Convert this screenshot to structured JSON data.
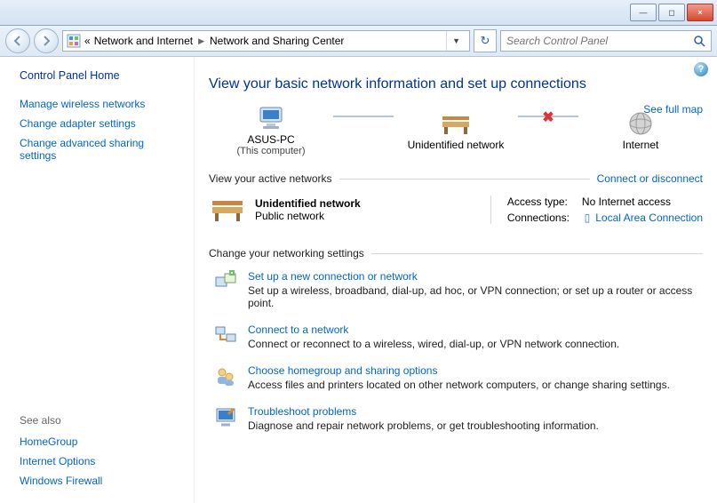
{
  "titlebar": {
    "minimize": "—",
    "maximize": "◻",
    "close": "×"
  },
  "breadcrumb": {
    "prefix": "«",
    "part1": "Network and Internet",
    "part2": "Network and Sharing Center"
  },
  "search": {
    "placeholder": "Search Control Panel"
  },
  "sidebar": {
    "home": "Control Panel Home",
    "links": [
      "Manage wireless networks",
      "Change adapter settings",
      "Change advanced sharing settings"
    ],
    "seealso_header": "See also",
    "seealso": [
      "HomeGroup",
      "Internet Options",
      "Windows Firewall"
    ]
  },
  "main": {
    "title": "View your basic network information and set up connections",
    "fullmap": "See full map",
    "map": {
      "node1": "ASUS-PC",
      "node1_sub": "(This computer)",
      "node2": "Unidentified network",
      "node3": "Internet"
    },
    "active_header": "View your active networks",
    "active_action": "Connect or disconnect",
    "active": {
      "name": "Unidentified network",
      "type": "Public network",
      "access_label": "Access type:",
      "access_value": "No Internet access",
      "conn_label": "Connections:",
      "conn_value": "Local Area Connection"
    },
    "change_header": "Change your networking settings",
    "settings": [
      {
        "title": "Set up a new connection or network",
        "desc": "Set up a wireless, broadband, dial-up, ad hoc, or VPN connection; or set up a router or access point."
      },
      {
        "title": "Connect to a network",
        "desc": "Connect or reconnect to a wireless, wired, dial-up, or VPN network connection."
      },
      {
        "title": "Choose homegroup and sharing options",
        "desc": "Access files and printers located on other network computers, or change sharing settings."
      },
      {
        "title": "Troubleshoot problems",
        "desc": "Diagnose and repair network problems, or get troubleshooting information."
      }
    ]
  }
}
